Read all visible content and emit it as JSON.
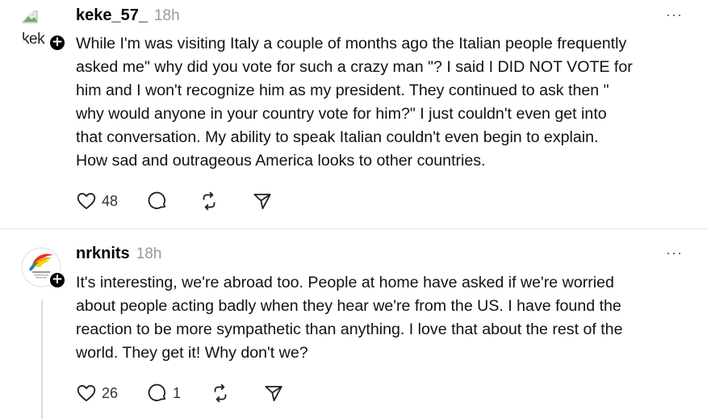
{
  "posts": [
    {
      "username": "keke_57_",
      "time": "18h",
      "avatar_text": "kek",
      "body": "While I'm was visiting Italy a couple of months ago the Italian people frequently\nasked me\" why did you vote for such a crazy man \"? I said I DID NOT VOTE for\nhim and I won't recognize him as my president. They continued to ask then \"\nwhy would anyone in your country vote for him?\" I just couldn't even get into\nthat conversation. My ability to speak Italian couldn't even begin to explain.\nHow sad and outrageous America looks to other countries.",
      "likes": "48",
      "replies": "",
      "more_label": "···"
    },
    {
      "username": "nrknits",
      "time": "18h",
      "body": "It's interesting, we're abroad too. People at home have asked if we're worried\nabout people acting badly when they hear we're from the US. I have found the\nreaction to be more sympathetic than anything. I love that about the rest of the\nworld. They get it! Why don't we?",
      "likes": "26",
      "replies": "1",
      "more_label": "···"
    }
  ],
  "icons": {
    "like": "heart-icon",
    "reply": "comment-icon",
    "repost": "repost-icon",
    "share": "share-icon",
    "follow": "plus-icon"
  },
  "colors": {
    "text": "#111111",
    "muted": "#999999",
    "divider": "#e6e6e6"
  }
}
